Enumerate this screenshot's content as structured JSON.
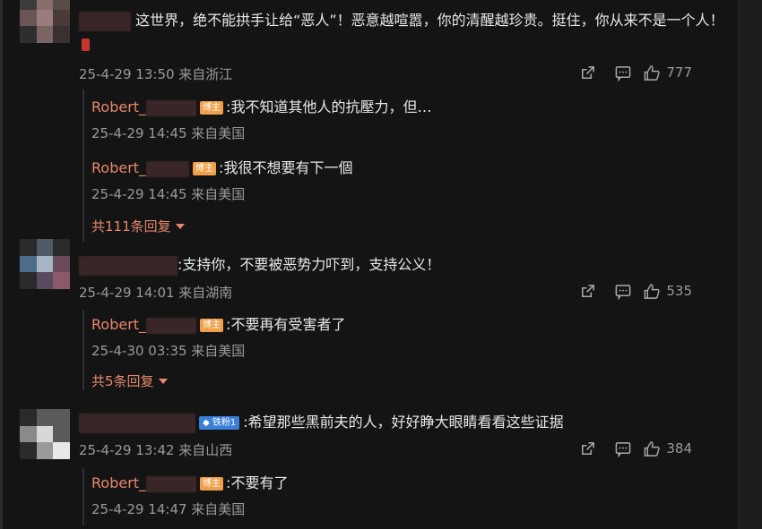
{
  "comments": [
    {
      "text": "这世界，绝不能拱手让给“恶人”！恶意越喧嚣，你的清醒越珍贵。挺住，你从来不是一个人！",
      "meta": "25-4-29 13:50 来自浙江",
      "likes": "777",
      "avatar_colors": [
        "#3c3c3c",
        "#8a6e6e",
        "#5a4a4a",
        "#6b5454",
        "#9b7c7c",
        "#4a3a3a",
        "#2e2e2e",
        "#7a6464",
        "#3a3030"
      ],
      "replies": [
        {
          "name": "Robert_",
          "badge": "博主",
          "text": ":我不知道其他人的抗壓力，但…",
          "meta": "25-4-29 14:45 来自美国"
        },
        {
          "name": "Robert_",
          "badge": "博主",
          "text": ":我很不想要有下一個",
          "meta": "25-4-29 14:45 来自美国"
        }
      ],
      "more": "共111条回复"
    },
    {
      "text": ":支持你，不要被恶势力吓到，支持公义！",
      "meta": "25-4-29 14:01 来自湖南",
      "likes": "535",
      "avatar_colors": [
        "#2a2a2a",
        "#4f5a66",
        "#2a2a2a",
        "#4c6d8a",
        "#a7b5c4",
        "#6a4a5a",
        "#2a2a2a",
        "#5a4a60",
        "#8a5a6a"
      ],
      "replies": [
        {
          "name": "Robert_",
          "badge": "博主",
          "text": ":不要再有受害者了",
          "meta": "25-4-30 03:35 来自美国"
        }
      ],
      "more": "共5条回复"
    },
    {
      "text": ":希望那些黑前夫的人，好好睁大眼睛看看这些证据",
      "meta": "25-4-29 13:42 来自山西",
      "likes": "384",
      "fan_badge": "铁粉1",
      "avatar_colors": [
        "#2a2a2a",
        "#5a5a5a",
        "#5a5a5a",
        "#8a8a8a",
        "#d8d8d8",
        "#5a5a5a",
        "#2a2a2a",
        "#9a9a9a",
        "#e8e8e8"
      ],
      "replies": [
        {
          "name": "Robert_",
          "badge": "博主",
          "text": ":不要有了",
          "meta": "25-4-29 14:47 来自美国"
        }
      ]
    }
  ],
  "icons": {
    "share": "share-icon",
    "comment": "comment-icon",
    "like": "like-icon"
  },
  "colors": {
    "background": "#141414",
    "name_accent": "#e9876d",
    "badge": "#f0a04b",
    "fan_badge": "#3b7fd9",
    "meta_text": "#9a9a9a"
  }
}
